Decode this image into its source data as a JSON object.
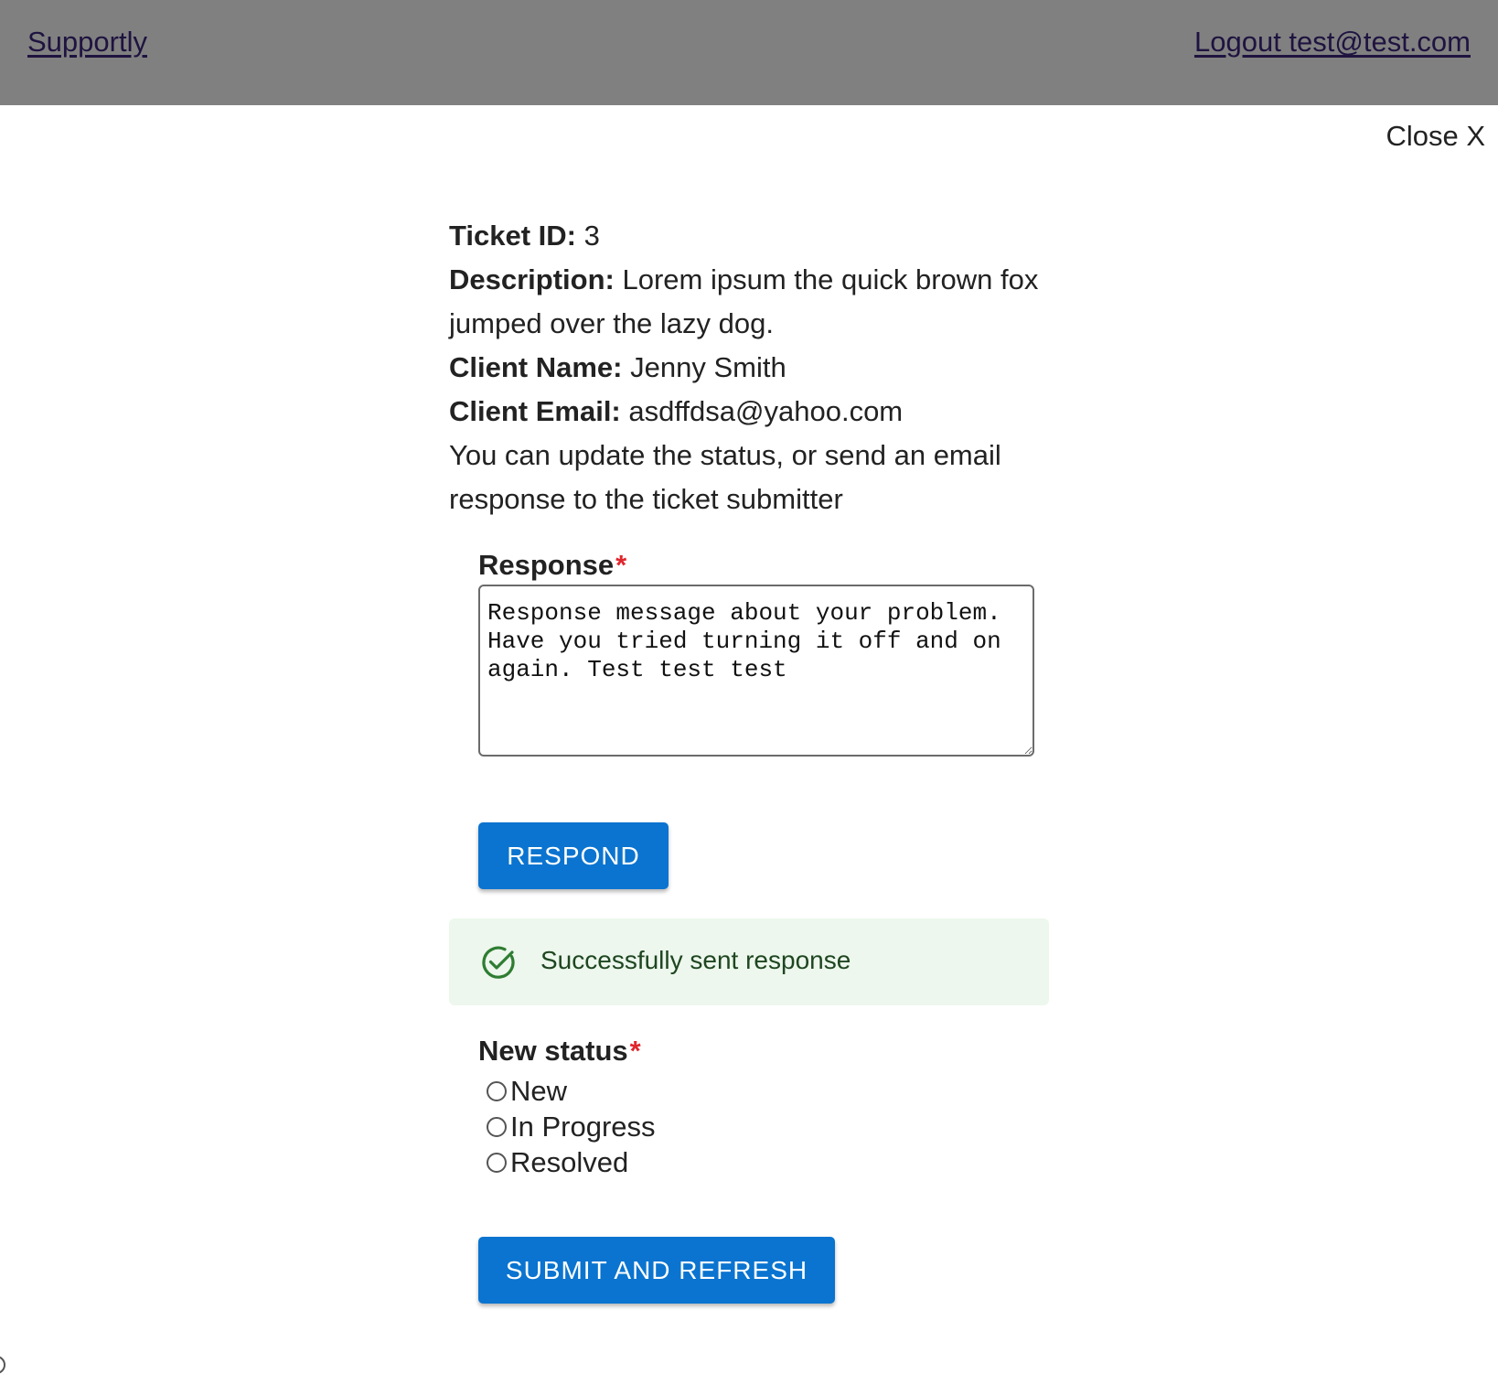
{
  "header": {
    "brand": "Supportly",
    "logout": "Logout test@test.com"
  },
  "close_label": "Close X",
  "ticket": {
    "id_label": "Ticket ID:",
    "id_value": "3",
    "description_label": "Description:",
    "description_value": "Lorem ipsum the quick brown fox jumped over the lazy dog.",
    "client_name_label": "Client Name:",
    "client_name_value": "Jenny Smith",
    "client_email_label": "Client Email:",
    "client_email_value": "asdffdsa@yahoo.com",
    "instructions": "You can update the status, or send an email response to the ticket submitter"
  },
  "response": {
    "label": "Response",
    "required_mark": "*",
    "value": "Response message about your problem. Have you tried turning it off and on again. Test test test"
  },
  "respond_button": "Respond",
  "alert": {
    "icon": "check-circle-icon",
    "message": "Successfully sent response",
    "color": "#2e7d32",
    "background": "#edf7ed"
  },
  "status": {
    "label": "New status",
    "required_mark": "*",
    "options": [
      "New",
      "In Progress",
      "Resolved"
    ],
    "selected": null
  },
  "submit_button": "Submit and Refresh",
  "colors": {
    "header_bg": "#808080",
    "button_bg": "#0a74d0",
    "required": "#e0262d",
    "link": "#1f1340"
  }
}
